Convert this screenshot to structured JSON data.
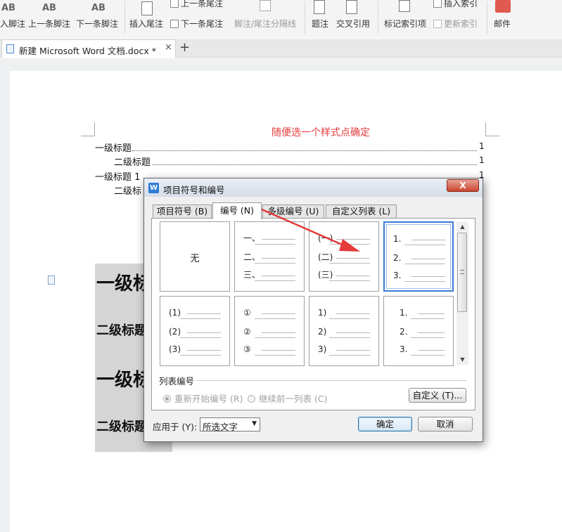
{
  "ribbon": {
    "items": [
      {
        "icon_text": "AB",
        "label": "入脚注"
      },
      {
        "icon_text": "AB",
        "label": "上一条脚注"
      },
      {
        "icon_text": "AB",
        "label": "下一条脚注"
      },
      {
        "label": "插入尾注"
      },
      {
        "label": "上一条尾注"
      },
      {
        "label": "下一条尾注"
      },
      {
        "label": "脚注/尾注分隔线"
      },
      {
        "label": "题注"
      },
      {
        "label": "交叉引用"
      },
      {
        "label": "标记索引项"
      },
      {
        "label": "插入索引"
      },
      {
        "label": "更新索引"
      },
      {
        "label": "邮件"
      }
    ],
    "accent_color": "#e05a4f"
  },
  "tabbar": {
    "doc_title": "新建 Microsoft Word 文档.docx *",
    "close": "×",
    "new_tab": "+"
  },
  "document": {
    "toc_title": "随便选一个样式点确定",
    "toc_color": "#e43b3b",
    "toc": [
      {
        "text": "一级标题",
        "page": "1"
      },
      {
        "text": "二级标题",
        "page": "1"
      },
      {
        "text": "一级标题 1",
        "page": "1"
      },
      {
        "text": "二级标",
        "page": ""
      }
    ],
    "headings": [
      {
        "text": "一级标",
        "level": 1
      },
      {
        "text": "二级标题",
        "level": 2
      },
      {
        "text": "一级标",
        "level": 1
      },
      {
        "text": "二级标题",
        "level": 2
      }
    ]
  },
  "dialog": {
    "title": "项目符号和编号",
    "app_icon": "W",
    "close": "X",
    "tabs": [
      {
        "label": "项目符号 (B)",
        "active": false
      },
      {
        "label": "编号 (N)",
        "active": true
      },
      {
        "label": "多级编号 (U)",
        "active": false
      },
      {
        "label": "自定义列表 (L)",
        "active": false
      }
    ],
    "styles": [
      {
        "name": "none",
        "none_label": "无",
        "markers": []
      },
      {
        "name": "chinese-comma",
        "markers": [
          "一、",
          "二、",
          "三、"
        ]
      },
      {
        "name": "chinese-paren",
        "markers": [
          "(一)",
          "(二)",
          "(三)"
        ]
      },
      {
        "name": "arabic-dot",
        "markers": [
          "1.",
          "2.",
          "3."
        ],
        "selected": true
      },
      {
        "name": "arabic-paren",
        "markers": [
          "(1)",
          "(2)",
          "(3)"
        ]
      },
      {
        "name": "circled",
        "markers": [
          "①",
          "②",
          "③"
        ]
      },
      {
        "name": "arabic-half-paren",
        "markers": [
          "1)",
          "2)",
          "3)"
        ]
      },
      {
        "name": "arabic-dot-indent",
        "markers": [
          "1.",
          "2.",
          "3."
        ]
      }
    ],
    "list_numbering_label": "列表编号",
    "restart_label": "重新开始编号 (R)",
    "continue_label": "继续前一列表 (C)",
    "customize_button": "自定义 (T)...",
    "apply_to_label": "应用于 (Y):",
    "apply_to_value": "所选文字",
    "ok_button": "确定",
    "cancel_button": "取消",
    "annotation_arrow_color": "#e43b3b"
  }
}
